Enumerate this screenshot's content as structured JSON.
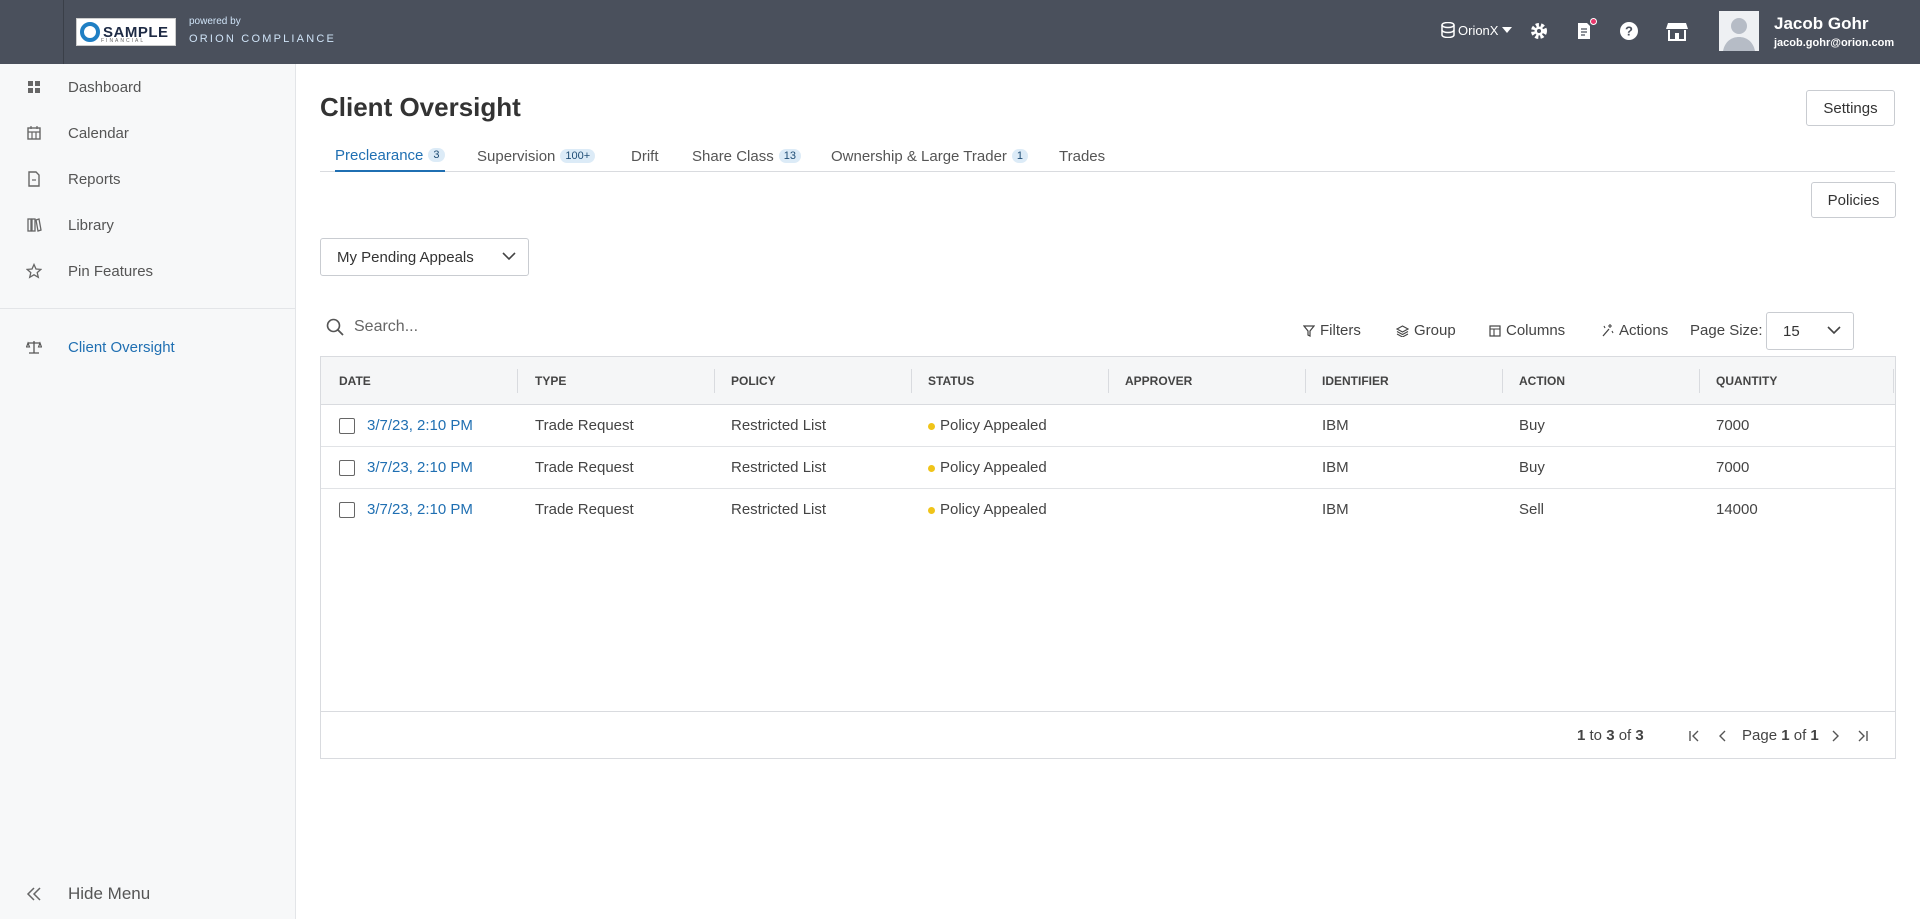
{
  "header": {
    "brand_logo_text": "SAMPLE",
    "brand_logo_sub": "FINANCIAL",
    "powered_by": "powered by",
    "product_name": "ORION COMPLIANCE",
    "org_name": "OrionX",
    "user_name": "Jacob Gohr",
    "user_email": "jacob.gohr@orion.com",
    "icons": [
      "database-icon",
      "settings-gear-icon",
      "notifications-icon",
      "help-icon",
      "store-icon"
    ],
    "notification_dot_color": "#e8366b"
  },
  "sidebar": {
    "items": [
      {
        "label": "Dashboard",
        "icon": "dashboard-grid-icon"
      },
      {
        "label": "Calendar",
        "icon": "calendar-icon"
      },
      {
        "label": "Reports",
        "icon": "document-icon"
      },
      {
        "label": "Library",
        "icon": "library-icon"
      },
      {
        "label": "Pin Features",
        "icon": "star-icon"
      },
      {
        "label": "Client Oversight",
        "icon": "scale-icon",
        "active": true
      }
    ],
    "hide_menu_label": "Hide Menu"
  },
  "page": {
    "title": "Client Oversight",
    "settings_button": "Settings",
    "policies_button": "Policies",
    "accent_color": "#1f6fb2"
  },
  "tabs": [
    {
      "label": "Preclearance",
      "badge": "3",
      "active": true
    },
    {
      "label": "Supervision",
      "badge": "100+"
    },
    {
      "label": "Drift",
      "badge": ""
    },
    {
      "label": "Share Class",
      "badge": "13"
    },
    {
      "label": "Ownership & Large Trader",
      "badge": "1"
    },
    {
      "label": "Trades",
      "badge": ""
    }
  ],
  "filter_select": {
    "value": "My Pending Appeals"
  },
  "toolbar": {
    "search_placeholder": "Search...",
    "filters_label": "Filters",
    "group_label": "Group",
    "columns_label": "Columns",
    "actions_label": "Actions",
    "page_size_label": "Page Size:",
    "page_size_value": "15"
  },
  "grid": {
    "columns": [
      "DATE",
      "TYPE",
      "POLICY",
      "STATUS",
      "APPROVER",
      "IDENTIFIER",
      "ACTION",
      "QUANTITY"
    ],
    "rows": [
      {
        "date": "3/7/23, 2:10 PM",
        "type": "Trade Request",
        "policy": "Restricted List",
        "status": "Policy Appealed",
        "approver": "",
        "identifier": "IBM",
        "action": "Buy",
        "quantity": "7000"
      },
      {
        "date": "3/7/23, 2:10 PM",
        "type": "Trade Request",
        "policy": "Restricted List",
        "status": "Policy Appealed",
        "approver": "",
        "identifier": "IBM",
        "action": "Buy",
        "quantity": "7000"
      },
      {
        "date": "3/7/23, 2:10 PM",
        "type": "Trade Request",
        "policy": "Restricted List",
        "status": "Policy Appealed",
        "approver": "",
        "identifier": "IBM",
        "action": "Sell",
        "quantity": "14000"
      }
    ],
    "status_dot_color": "#f0c419"
  },
  "pagination": {
    "from": "1",
    "to_word": "to",
    "to": "3",
    "of_word": "of",
    "total": "3",
    "page_word": "Page",
    "current_page": "1",
    "total_pages": "1"
  }
}
